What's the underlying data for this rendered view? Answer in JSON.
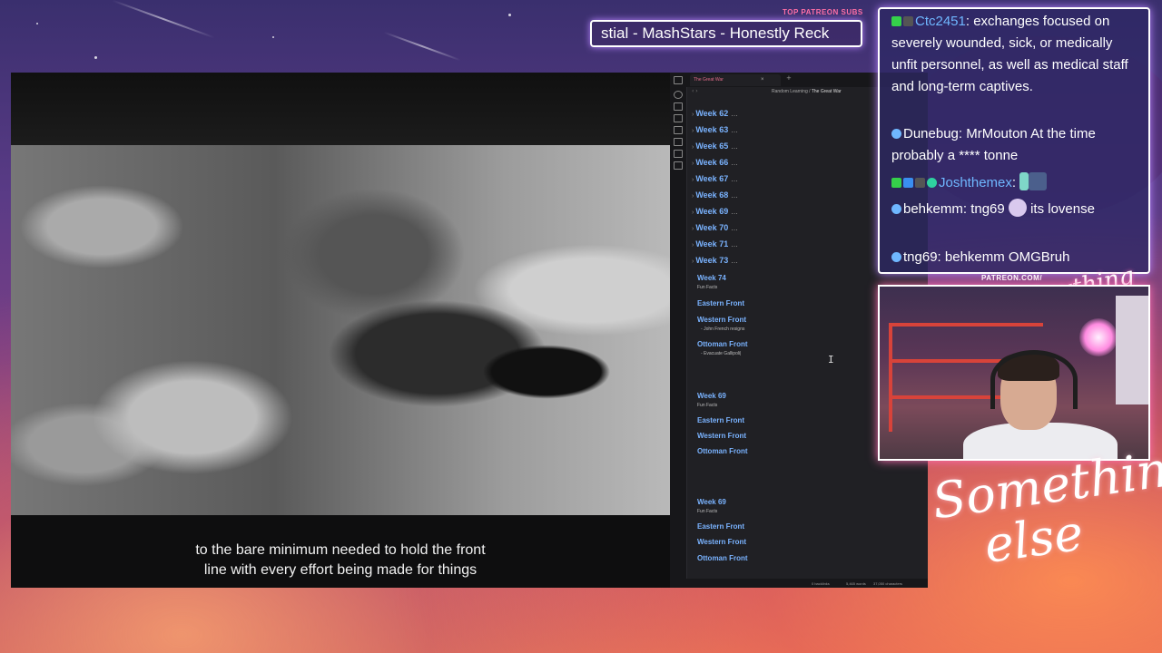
{
  "ticker": {
    "label": "TOP PATREON SUBS",
    "text": "stial - MashStars - Honestly Reck"
  },
  "video": {
    "subtitle_line1": "to the bare minimum needed to hold the front",
    "subtitle_line2": "line with every effort being made for things"
  },
  "editor": {
    "tab_title": "The Great War",
    "tab_close": "×",
    "tab_new": "+",
    "nav_arrows": "‹ ›",
    "breadcrumb": {
      "parent": "Random Learning",
      "sep": "/",
      "current": "The Great War"
    },
    "collapsed_weeks": [
      "Week 62",
      "Week 63",
      "Week 65",
      "Week 66",
      "Week 67",
      "Week 68",
      "Week 69",
      "Week 70",
      "Week 71",
      "Week 73"
    ],
    "ellipsis": "...",
    "sections": [
      {
        "week": "Week 74",
        "fun_facts": "Fun Facts",
        "headings": [
          "Eastern Front",
          "Western Front",
          "Ottoman Front"
        ],
        "western_items": [
          "John French resigns"
        ],
        "ottoman_items": [
          "Evacuate Gallipoli"
        ]
      },
      {
        "week": "Week 69",
        "fun_facts": "Fun Facts",
        "headings": [
          "Eastern Front",
          "Western Front",
          "Ottoman Front"
        ]
      },
      {
        "week": "Week 69",
        "fun_facts": "Fun Facts",
        "headings": [
          "Eastern Front",
          "Western Front",
          "Ottoman Front"
        ]
      }
    ],
    "status": {
      "backlinks": "0 backlinks",
      "words": "5,465 words",
      "chars": "37,050 characters"
    }
  },
  "chat": {
    "messages": [
      {
        "user": "Ctc2451",
        "user_color": "#6fb7ff",
        "text": ": exchanges focused on severely wounded, sick, or medically unfit personnel, as well as medical staff and long-term captives."
      },
      {
        "user": "Dunebug",
        "text": ": MrMouton At the time probably a **** tonne"
      },
      {
        "user": "Joshthemex",
        "user_color": "#6fb7ff",
        "text": ":"
      },
      {
        "user": "behkemm",
        "text": ": tng69",
        "text2": "its lovense"
      },
      {
        "user": "tng69",
        "text": ": behkemm OMGBruh"
      }
    ]
  },
  "webcam": {
    "label": "PATREON.COM/",
    "script": "Anything else?"
  },
  "branding": {
    "line1": "Something",
    "line2": "else"
  }
}
